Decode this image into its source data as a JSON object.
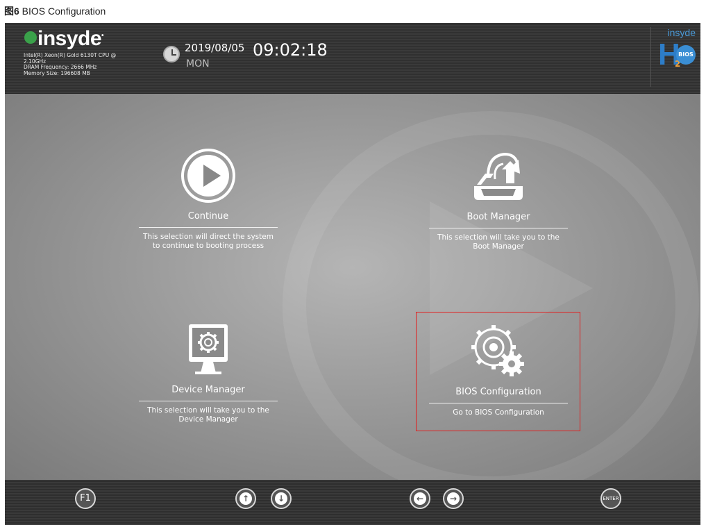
{
  "caption": {
    "prefix": "图6",
    "text": " BIOS Configuration"
  },
  "header": {
    "brand": "insyde",
    "cpu_line1": "Intel(R) Xeon(R) Gold 6130T CPU @",
    "cpu_line2": "2.10GHz",
    "dram": "DRAM Frequency: 2666 MHz",
    "memory": "Memory Size: 196608 MB",
    "date": "2019/08/05",
    "time": "09:02:18",
    "weekday": "MON",
    "logo_brand": "insyde",
    "logo_h": "H",
    "logo_2": "2",
    "logo_bios": "BIOS"
  },
  "menu": {
    "continue": {
      "title": "Continue",
      "desc": "This selection will direct the system to continue to booting process"
    },
    "boot_manager": {
      "title": "Boot Manager",
      "desc": "This selection will take you to the Boot Manager"
    },
    "device_manager": {
      "title": "Device Manager",
      "desc": "This selection will take you to the Device Manager"
    },
    "bios_config": {
      "title": "BIOS Configuration",
      "desc": "Go to BIOS Configuration"
    }
  },
  "footer": {
    "f1": "F1",
    "up": "↑",
    "down": "↓",
    "left": "←",
    "right": "→",
    "enter": "ENTER"
  },
  "colors": {
    "highlight": "#e02020",
    "logo_green": "#3aa14a",
    "h2o_blue": "#2d7dc8"
  }
}
